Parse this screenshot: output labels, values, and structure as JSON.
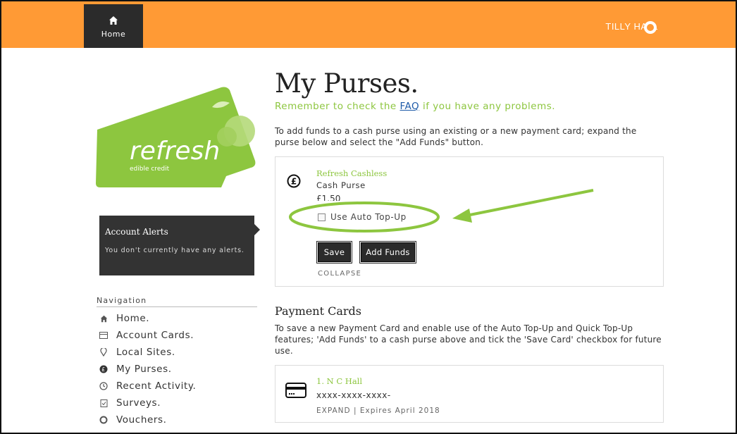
{
  "header": {
    "home_label": "Home",
    "user_name": "TILLY HALL"
  },
  "brand_card": {
    "wordmark": "refresh",
    "tagline": "edible credit",
    "color": "#8dc63f"
  },
  "alerts": {
    "title": "Account Alerts",
    "message": "You don't currently have any alerts."
  },
  "navigation": {
    "title": "Navigation",
    "items": [
      {
        "label": "Home.",
        "icon": "home-icon"
      },
      {
        "label": "Account Cards.",
        "icon": "card-icon"
      },
      {
        "label": "Local Sites.",
        "icon": "location-pin-icon"
      },
      {
        "label": "My Purses.",
        "icon": "purse-icon"
      },
      {
        "label": "Recent Activity.",
        "icon": "clock-icon"
      },
      {
        "label": "Surveys.",
        "icon": "clipboard-icon"
      },
      {
        "label": "Vouchers.",
        "icon": "ring-icon"
      }
    ]
  },
  "main": {
    "title": "My Purses.",
    "subtitle_prefix": "Remember to check the ",
    "subtitle_link": "FAQ",
    "subtitle_suffix": " if you have any problems.",
    "intro": "To add funds to a cash purse using an existing or a new payment card; expand the purse below and select the \"Add Funds\" button."
  },
  "purse": {
    "name": "Refresh Cashless",
    "type": "Cash Purse",
    "balance": "£1.50",
    "auto_topup_label": "Use Auto Top-Up",
    "auto_topup_checked": false,
    "save_label": "Save",
    "add_funds_label": "Add Funds",
    "collapse_label": "COLLAPSE"
  },
  "payment_cards": {
    "title": "Payment Cards",
    "description": "To save a new Payment Card and enable use of the Auto Top-Up and Quick Top-Up features; 'Add Funds' to a cash purse above and tick the 'Save Card' checkbox for future use.",
    "cards": [
      {
        "name": "1. N C Hall",
        "number": "xxxx-xxxx-xxxx-",
        "expand_label": "EXPAND",
        "expires": "Expires April 2018"
      }
    ]
  },
  "colors": {
    "header": "#ff9a35",
    "accent_green": "#8dc63f",
    "dark": "#2b2b2b",
    "annotation": "#8dc63f"
  }
}
